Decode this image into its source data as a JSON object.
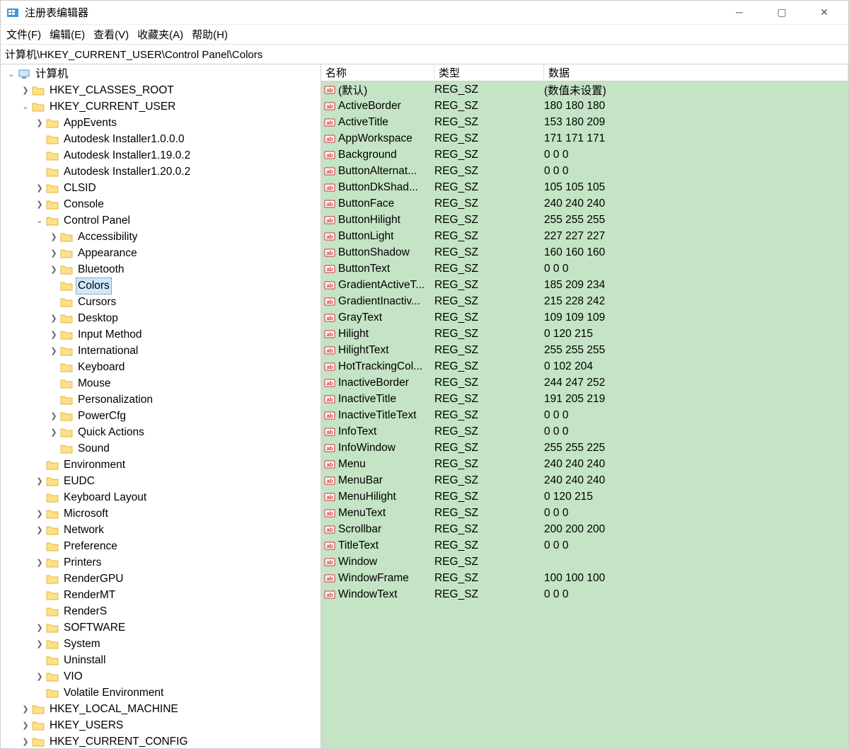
{
  "window": {
    "title": "注册表编辑器"
  },
  "menu": {
    "file": "文件(F)",
    "edit": "编辑(E)",
    "view": "查看(V)",
    "favorites": "收藏夹(A)",
    "help": "帮助(H)"
  },
  "address": "计算机\\HKEY_CURRENT_USER\\Control Panel\\Colors",
  "tree": [
    {
      "d": 0,
      "t": "v",
      "k": "computer",
      "l": "计算机",
      "icon": "pc"
    },
    {
      "d": 1,
      "t": ">",
      "k": "hkcr",
      "l": "HKEY_CLASSES_ROOT"
    },
    {
      "d": 1,
      "t": "v",
      "k": "hkcu",
      "l": "HKEY_CURRENT_USER"
    },
    {
      "d": 2,
      "t": ">",
      "k": "appevents",
      "l": "AppEvents"
    },
    {
      "d": 2,
      "t": "",
      "k": "ai1",
      "l": "Autodesk Installer1.0.0.0"
    },
    {
      "d": 2,
      "t": "",
      "k": "ai2",
      "l": "Autodesk Installer1.19.0.2"
    },
    {
      "d": 2,
      "t": "",
      "k": "ai3",
      "l": "Autodesk Installer1.20.0.2"
    },
    {
      "d": 2,
      "t": ">",
      "k": "clsid",
      "l": "CLSID"
    },
    {
      "d": 2,
      "t": ">",
      "k": "console",
      "l": "Console"
    },
    {
      "d": 2,
      "t": "v",
      "k": "cpanel",
      "l": "Control Panel"
    },
    {
      "d": 3,
      "t": ">",
      "k": "access",
      "l": "Accessibility"
    },
    {
      "d": 3,
      "t": ">",
      "k": "appear",
      "l": "Appearance"
    },
    {
      "d": 3,
      "t": ">",
      "k": "bt",
      "l": "Bluetooth"
    },
    {
      "d": 3,
      "t": "",
      "k": "colors",
      "l": "Colors",
      "sel": true
    },
    {
      "d": 3,
      "t": "",
      "k": "cursors",
      "l": "Cursors"
    },
    {
      "d": 3,
      "t": ">",
      "k": "desktop",
      "l": "Desktop"
    },
    {
      "d": 3,
      "t": ">",
      "k": "im",
      "l": "Input Method"
    },
    {
      "d": 3,
      "t": ">",
      "k": "intl",
      "l": "International"
    },
    {
      "d": 3,
      "t": "",
      "k": "kbd",
      "l": "Keyboard"
    },
    {
      "d": 3,
      "t": "",
      "k": "mouse",
      "l": "Mouse"
    },
    {
      "d": 3,
      "t": "",
      "k": "pers",
      "l": "Personalization"
    },
    {
      "d": 3,
      "t": ">",
      "k": "pcfg",
      "l": "PowerCfg"
    },
    {
      "d": 3,
      "t": ">",
      "k": "qa",
      "l": "Quick Actions"
    },
    {
      "d": 3,
      "t": "",
      "k": "sound",
      "l": "Sound"
    },
    {
      "d": 2,
      "t": "",
      "k": "env",
      "l": "Environment"
    },
    {
      "d": 2,
      "t": ">",
      "k": "eudc",
      "l": "EUDC"
    },
    {
      "d": 2,
      "t": "",
      "k": "kl",
      "l": "Keyboard Layout"
    },
    {
      "d": 2,
      "t": ">",
      "k": "ms",
      "l": "Microsoft"
    },
    {
      "d": 2,
      "t": ">",
      "k": "net",
      "l": "Network"
    },
    {
      "d": 2,
      "t": "",
      "k": "pref",
      "l": "Preference"
    },
    {
      "d": 2,
      "t": ">",
      "k": "prn",
      "l": "Printers"
    },
    {
      "d": 2,
      "t": "",
      "k": "rgpu",
      "l": "RenderGPU"
    },
    {
      "d": 2,
      "t": "",
      "k": "rmt",
      "l": "RenderMT"
    },
    {
      "d": 2,
      "t": "",
      "k": "rs",
      "l": "RenderS"
    },
    {
      "d": 2,
      "t": ">",
      "k": "sw",
      "l": "SOFTWARE"
    },
    {
      "d": 2,
      "t": ">",
      "k": "sys",
      "l": "System"
    },
    {
      "d": 2,
      "t": "",
      "k": "uninst",
      "l": "Uninstall"
    },
    {
      "d": 2,
      "t": ">",
      "k": "vio",
      "l": "VIO"
    },
    {
      "d": 2,
      "t": "",
      "k": "ve",
      "l": "Volatile Environment"
    },
    {
      "d": 1,
      "t": ">",
      "k": "hklm",
      "l": "HKEY_LOCAL_MACHINE"
    },
    {
      "d": 1,
      "t": ">",
      "k": "hku",
      "l": "HKEY_USERS"
    },
    {
      "d": 1,
      "t": ">",
      "k": "hkcc",
      "l": "HKEY_CURRENT_CONFIG"
    }
  ],
  "columns": {
    "name": "名称",
    "type": "类型",
    "data": "数据"
  },
  "values": [
    {
      "n": "(默认)",
      "t": "REG_SZ",
      "d": "(数值未设置)"
    },
    {
      "n": "ActiveBorder",
      "t": "REG_SZ",
      "d": "180 180 180"
    },
    {
      "n": "ActiveTitle",
      "t": "REG_SZ",
      "d": "153 180 209"
    },
    {
      "n": "AppWorkspace",
      "t": "REG_SZ",
      "d": "171 171 171"
    },
    {
      "n": "Background",
      "t": "REG_SZ",
      "d": "0 0 0"
    },
    {
      "n": "ButtonAlternat...",
      "t": "REG_SZ",
      "d": "0 0 0"
    },
    {
      "n": "ButtonDkShad...",
      "t": "REG_SZ",
      "d": "105 105 105"
    },
    {
      "n": "ButtonFace",
      "t": "REG_SZ",
      "d": "240 240 240"
    },
    {
      "n": "ButtonHilight",
      "t": "REG_SZ",
      "d": "255 255 255"
    },
    {
      "n": "ButtonLight",
      "t": "REG_SZ",
      "d": "227 227 227"
    },
    {
      "n": "ButtonShadow",
      "t": "REG_SZ",
      "d": "160 160 160"
    },
    {
      "n": "ButtonText",
      "t": "REG_SZ",
      "d": "0 0 0"
    },
    {
      "n": "GradientActiveT...",
      "t": "REG_SZ",
      "d": "185 209 234"
    },
    {
      "n": "GradientInactiv...",
      "t": "REG_SZ",
      "d": "215 228 242"
    },
    {
      "n": "GrayText",
      "t": "REG_SZ",
      "d": "109 109 109"
    },
    {
      "n": "Hilight",
      "t": "REG_SZ",
      "d": "0 120 215"
    },
    {
      "n": "HilightText",
      "t": "REG_SZ",
      "d": "255 255 255"
    },
    {
      "n": "HotTrackingCol...",
      "t": "REG_SZ",
      "d": "0 102 204"
    },
    {
      "n": "InactiveBorder",
      "t": "REG_SZ",
      "d": "244 247 252"
    },
    {
      "n": "InactiveTitle",
      "t": "REG_SZ",
      "d": "191 205 219"
    },
    {
      "n": "InactiveTitleText",
      "t": "REG_SZ",
      "d": "0 0 0"
    },
    {
      "n": "InfoText",
      "t": "REG_SZ",
      "d": "0 0 0"
    },
    {
      "n": "InfoWindow",
      "t": "REG_SZ",
      "d": "255 255 225"
    },
    {
      "n": "Menu",
      "t": "REG_SZ",
      "d": "240 240 240"
    },
    {
      "n": "MenuBar",
      "t": "REG_SZ",
      "d": "240 240 240"
    },
    {
      "n": "MenuHilight",
      "t": "REG_SZ",
      "d": "0 120 215"
    },
    {
      "n": "MenuText",
      "t": "REG_SZ",
      "d": "0 0 0"
    },
    {
      "n": "Scrollbar",
      "t": "REG_SZ",
      "d": "200 200 200"
    },
    {
      "n": "TitleText",
      "t": "REG_SZ",
      "d": "0 0 0"
    },
    {
      "n": "Window",
      "t": "REG_SZ",
      "d": ""
    },
    {
      "n": "WindowFrame",
      "t": "REG_SZ",
      "d": "100 100 100"
    },
    {
      "n": "WindowText",
      "t": "REG_SZ",
      "d": "0 0 0"
    }
  ]
}
